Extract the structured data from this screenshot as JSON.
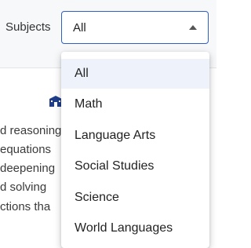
{
  "filter": {
    "label": "Subjects",
    "selected": "All",
    "caret_icon": "caret-up-icon"
  },
  "menu": {
    "options": [
      "All",
      "Math",
      "Language Arts",
      "Social Studies",
      "Science",
      "World Languages"
    ],
    "selected_index": 0
  },
  "background": {
    "icon": "school-icon",
    "icon_color": "#1f3d8a",
    "lines": [
      "d reasoning",
      "equations",
      "deepening",
      "d solving",
      "ctions tha"
    ]
  },
  "colors": {
    "accent": "#2f5ec4",
    "selected_bg": "#eef3fb"
  }
}
